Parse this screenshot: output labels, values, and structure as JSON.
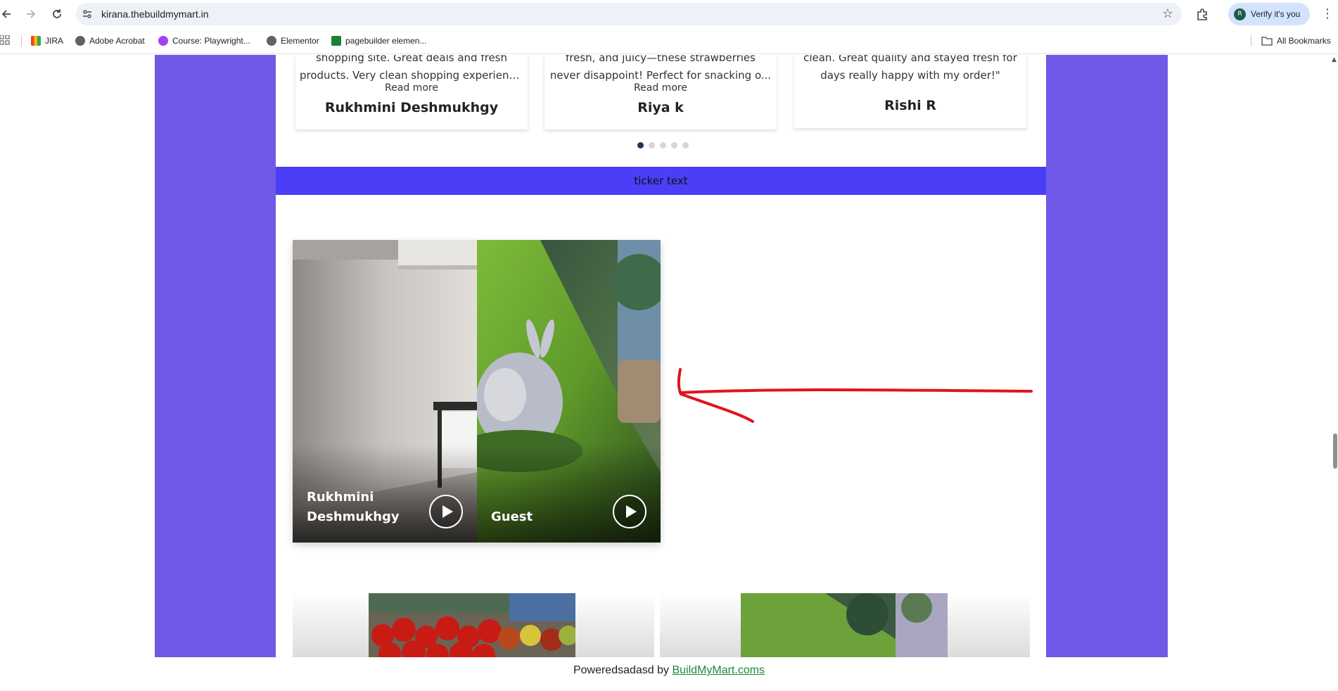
{
  "browser": {
    "url": "kirana.thebuildmymart.in",
    "profile_label": "Verify it's you",
    "profile_initial": "R",
    "icons": [
      "back-icon",
      "forward-icon",
      "reload-icon",
      "site-info-icon",
      "star-icon",
      "extensions-icon",
      "menu-icon"
    ]
  },
  "bookmarks": {
    "items": [
      {
        "label": "JIRA",
        "icon": "gmail-icon"
      },
      {
        "label": "Adobe Acrobat",
        "icon": "globe-icon"
      },
      {
        "label": "Course: Playwright...",
        "icon": "course-icon"
      },
      {
        "label": "Elementor",
        "icon": "globe-icon"
      },
      {
        "label": "pagebuilder elemen...",
        "icon": "sheets-icon"
      }
    ],
    "all_label": "All Bookmarks"
  },
  "testimonials": [
    {
      "quote_line1": "shopping site. Great deals and fresh",
      "quote_line2": "products. Very clean shopping experienc...",
      "read_more": "Read more",
      "name": "Rukhmini Deshmukhgy"
    },
    {
      "quote_line1": "fresh, and juicy—these strawberries",
      "quote_line2": "never disappoint! Perfect for snacking o...",
      "read_more": "Read more",
      "name": "Riya k"
    },
    {
      "quote_line1": "clean. Great quality and stayed fresh for",
      "quote_line2": "days really happy with my order!\"",
      "read_more": "",
      "name": "Rishi R"
    }
  ],
  "carousel": {
    "dot_count": 5,
    "active_index": 0
  },
  "ticker": {
    "text": "ticker text"
  },
  "videos": [
    {
      "name": "Rukhmini Deshmukhgy"
    },
    {
      "name": "Guest"
    }
  ],
  "footer": {
    "prefix": "Poweredsadasd by ",
    "link_text": "BuildMyMart.coms"
  },
  "colors": {
    "side_purple": "#7159e7",
    "ticker_blue": "#4a3ff7",
    "annotation_red": "#e0141b",
    "footer_link": "#1a8a3a"
  }
}
